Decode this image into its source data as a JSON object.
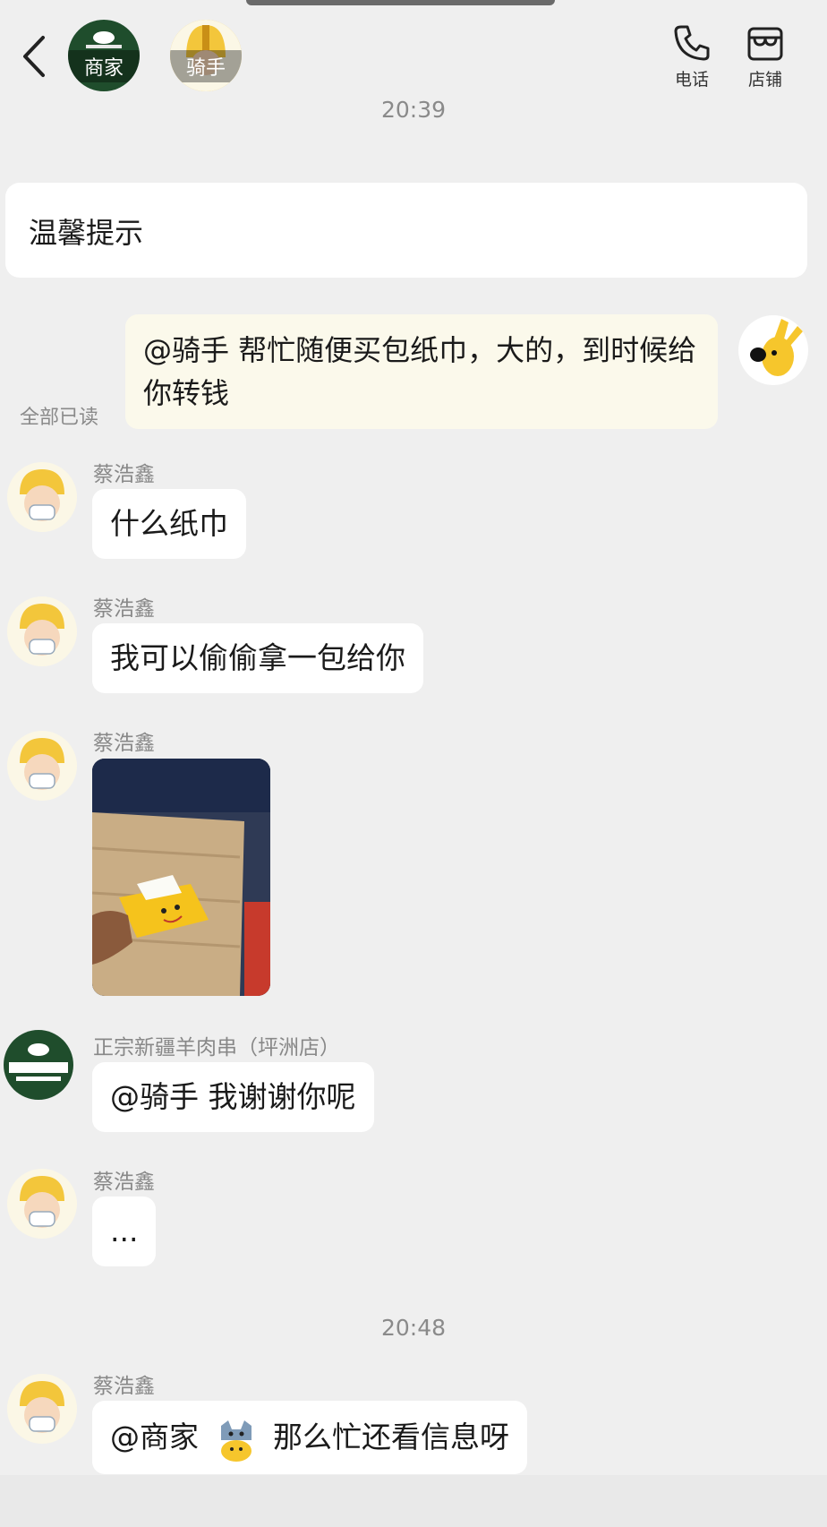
{
  "header": {
    "merchant_avatar_label": "商家",
    "rider_avatar_label": "骑手",
    "phone_label": "电话",
    "store_label": "店铺"
  },
  "timestamps": [
    "20:39",
    "20:48"
  ],
  "notice": {
    "title": "温馨提示"
  },
  "self_message": {
    "text": "@骑手 帮忙随便买包纸巾，大的，到时候给你转钱",
    "status": "全部已读"
  },
  "messages": [
    {
      "sender": "蔡浩鑫",
      "text": "什么纸巾"
    },
    {
      "sender": "蔡浩鑫",
      "text": "我可以偷偷拿一包给你"
    },
    {
      "sender": "蔡浩鑫",
      "type": "image"
    },
    {
      "sender": "正宗新疆羊肉串（坪洲店）",
      "text": "@骑手 我谢谢你呢"
    },
    {
      "sender": "蔡浩鑫",
      "text": "..."
    },
    {
      "sender": "蔡浩鑫",
      "text_before": "@商家",
      "text_after": "那么忙还看信息呀"
    }
  ],
  "colors": {
    "background": "#efefef",
    "self_bubble": "#fbf9eb",
    "merchant_green": "#1f4d2c",
    "rider_yellow": "#f3c63b"
  }
}
